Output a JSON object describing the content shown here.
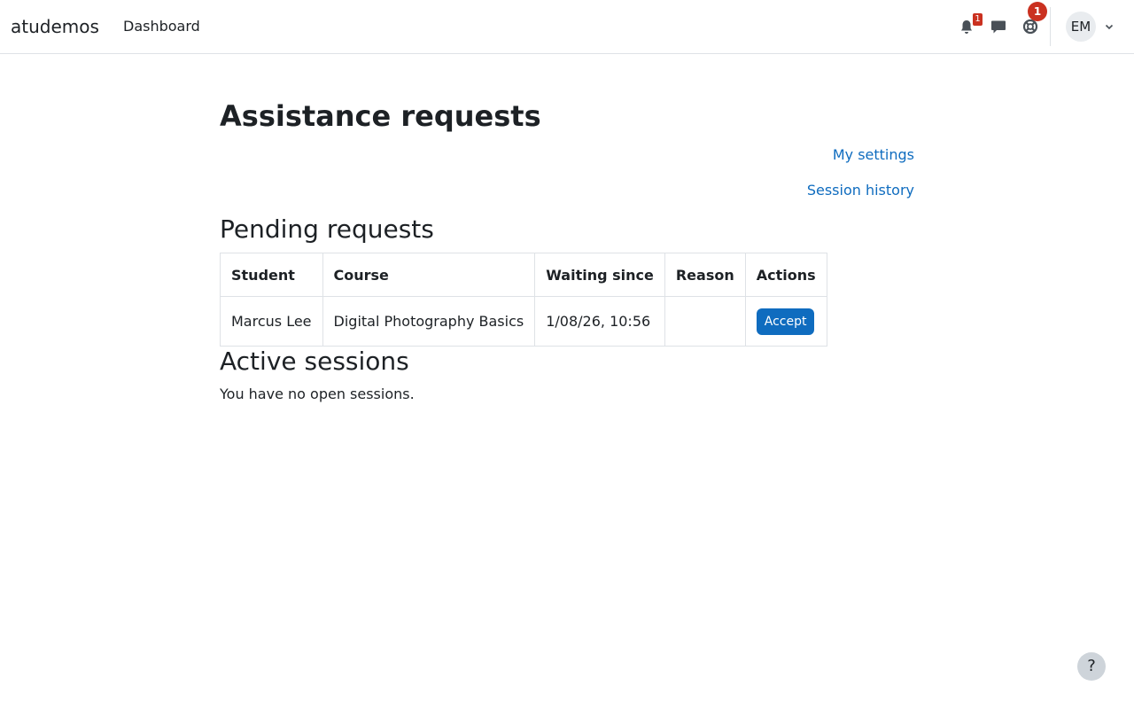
{
  "navbar": {
    "brand": "atudemos",
    "primary_nav": [
      {
        "label": "Dashboard"
      }
    ],
    "notifications": {
      "icon": "bell-icon",
      "count": "1"
    },
    "messages": {
      "icon": "chat-bubble-icon"
    },
    "assistance": {
      "icon": "lifebuoy-icon",
      "count": "1"
    },
    "user": {
      "initials": "EM",
      "caret_icon": "chevron-down-icon"
    }
  },
  "page": {
    "title": "Assistance requests",
    "links": {
      "my_settings": "My settings",
      "session_history": "Session history"
    }
  },
  "pending": {
    "heading": "Pending requests",
    "columns": [
      "Student",
      "Course",
      "Waiting since",
      "Reason",
      "Actions"
    ],
    "rows": [
      {
        "student": "Marcus Lee",
        "course": "Digital Photography Basics",
        "waiting_since": "1/08/26, 10:56",
        "reason": "",
        "action_label": "Accept"
      }
    ]
  },
  "active": {
    "heading": "Active sessions",
    "empty_text": "You have no open sessions."
  },
  "footer": {
    "help_label": "?"
  },
  "colors": {
    "link": "#0f6cbf",
    "primary_button": "#0f6cbf",
    "badge": "#ca3120",
    "text": "#1d2125",
    "border": "#dee2e6"
  }
}
